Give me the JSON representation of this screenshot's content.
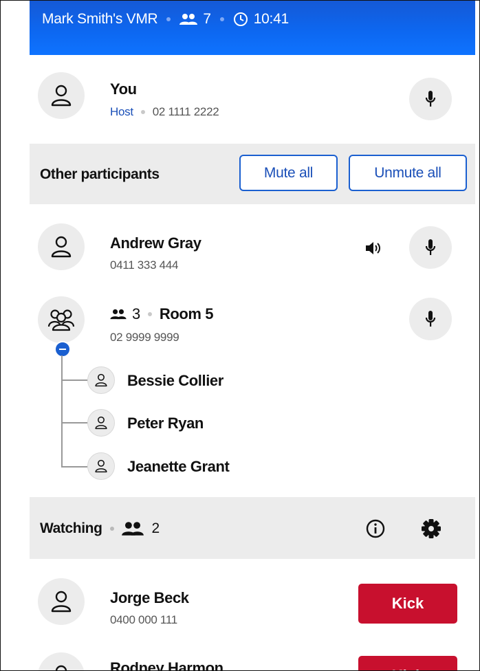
{
  "header": {
    "vmr_title": "Mark Smith's VMR",
    "participant_count": "7",
    "time": "10:41"
  },
  "self": {
    "name": "You",
    "role": "Host",
    "phone": "02 1111 2222"
  },
  "other_section": {
    "title": "Other participants",
    "mute_all_label": "Mute all",
    "unmute_all_label": "Unmute all"
  },
  "participants": [
    {
      "name": "Andrew Gray",
      "phone": "0411 333 444"
    }
  ],
  "room": {
    "count": "3",
    "name": "Room 5",
    "phone": "02 9999 9999",
    "members": [
      "Bessie Collier",
      "Peter Ryan",
      "Jeanette Grant"
    ]
  },
  "watching": {
    "title": "Watching",
    "count": "2",
    "viewers": [
      {
        "name": "Jorge Beck",
        "phone": "0400 000 111",
        "kick_label": "Kick"
      },
      {
        "name": "Rodney Harmon",
        "kick_label": "Kick"
      }
    ]
  },
  "colors": {
    "accent_blue": "#0e6bf5",
    "kick_red": "#c8102e",
    "band_gray": "#ececec"
  }
}
